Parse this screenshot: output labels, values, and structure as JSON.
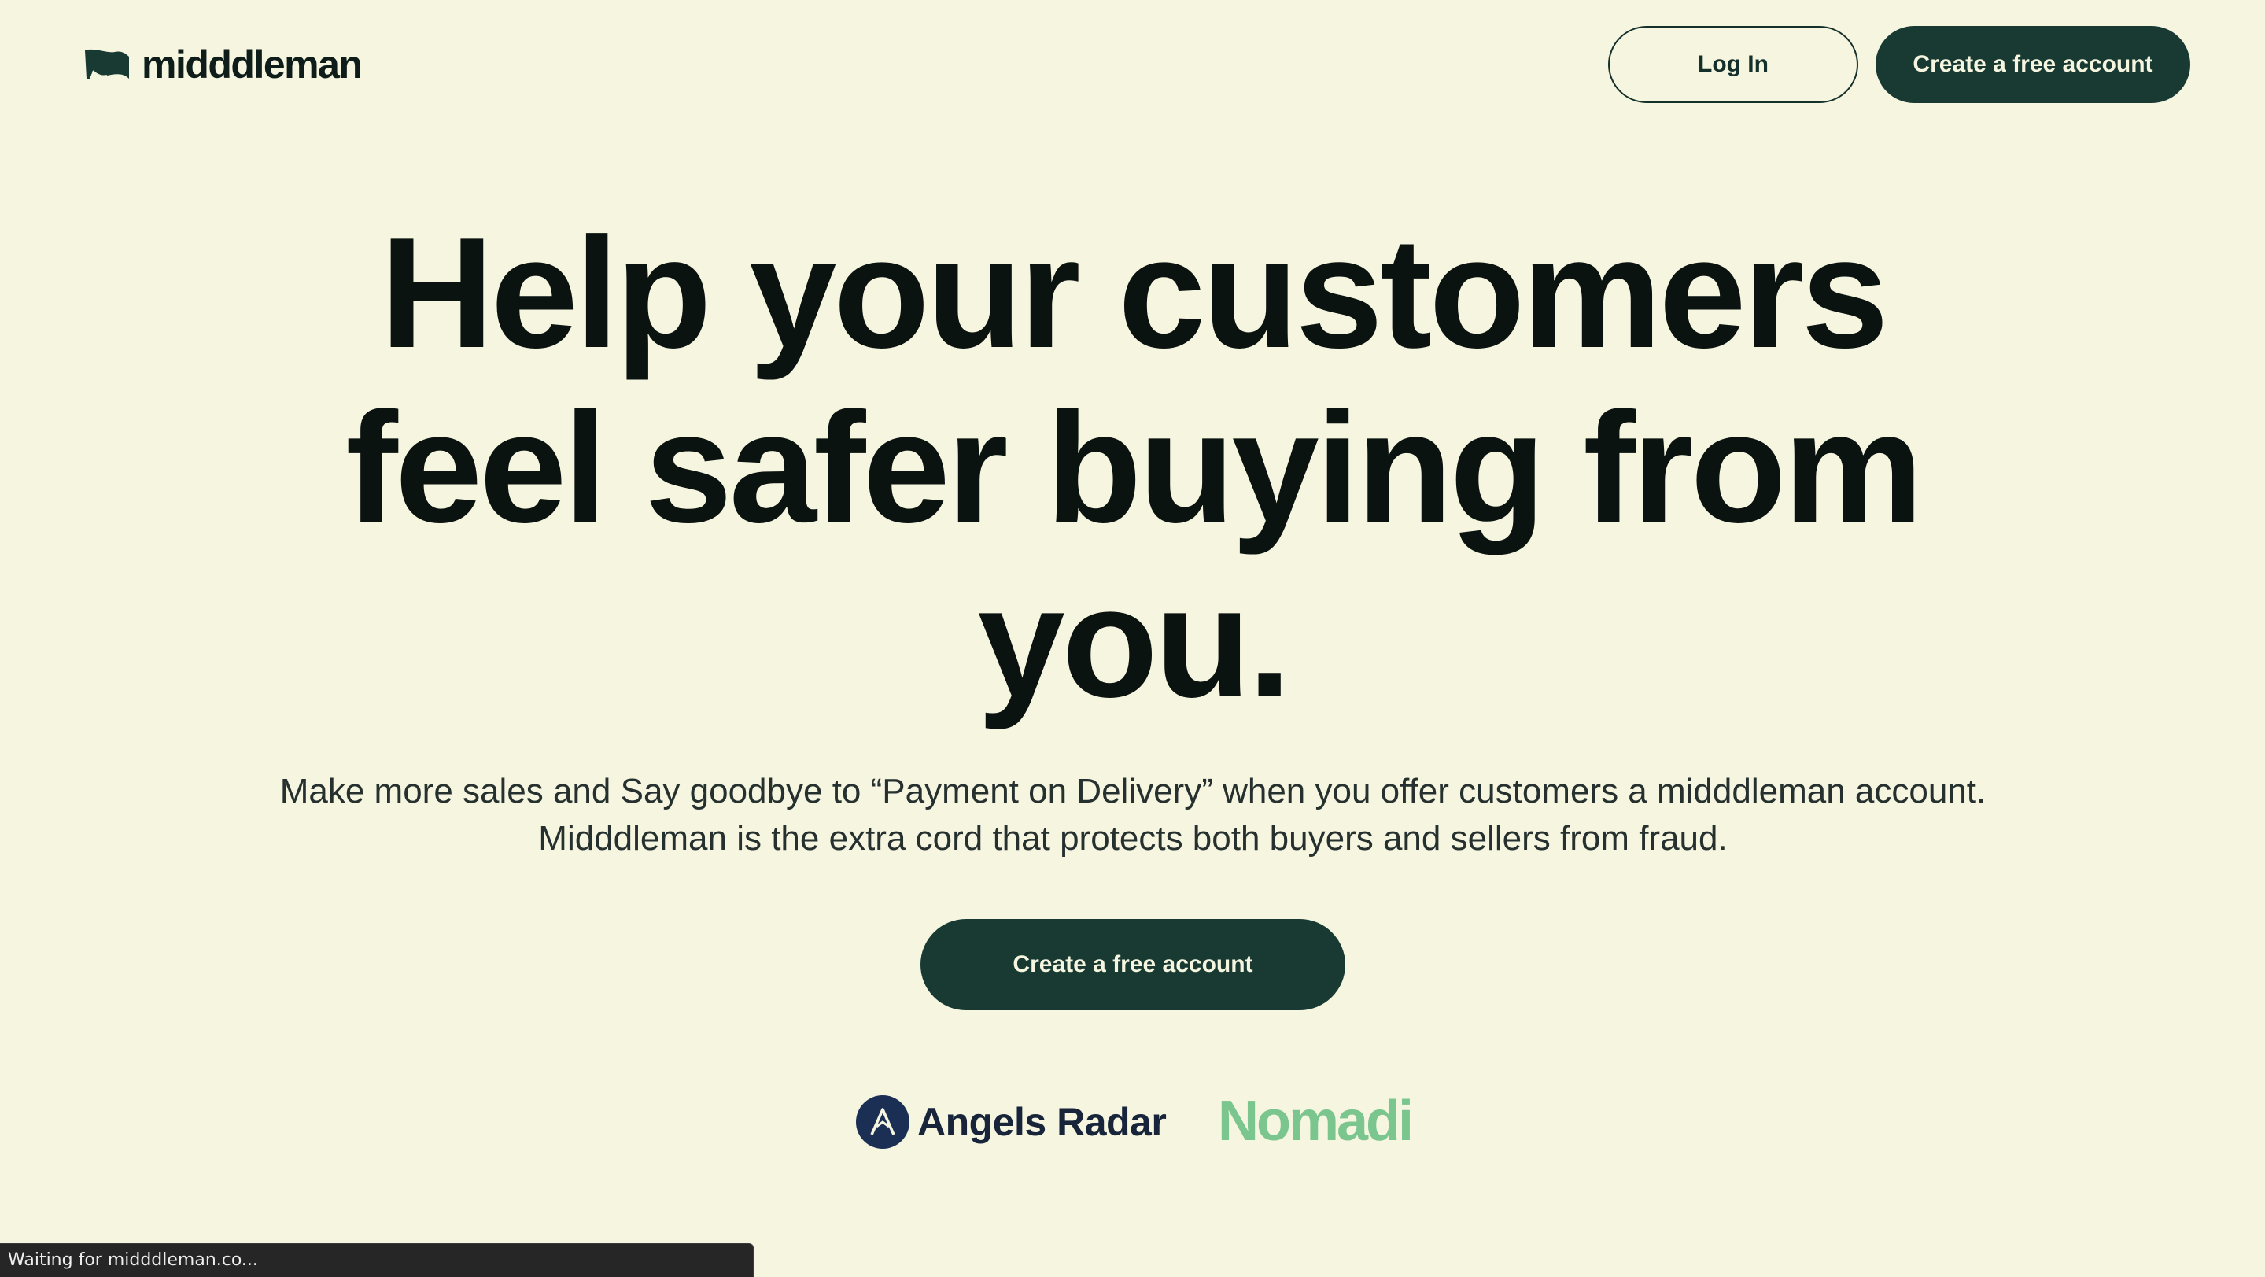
{
  "header": {
    "logo_text": "midddleman",
    "login_label": "Log In",
    "create_account_label": "Create a free account"
  },
  "hero": {
    "title": "Help your customers feel safer buying from you.",
    "subtitle": "Make more sales and Say goodbye to “Payment on Delivery” when you offer customers a midddleman account. Midddleman is the extra cord that protects both buyers and sellers from fraud.",
    "cta_label": "Create a free account"
  },
  "partners": {
    "angels_radar": "Angels Radar",
    "nomadi": "Nomadi"
  },
  "status_bar": {
    "text": "Waiting for midddleman.co..."
  },
  "colors": {
    "background": "#f5f5e0",
    "primary": "#183a33",
    "text": "#0b1311",
    "nomadi_green": "#7bc58e",
    "angels_blue": "#1b2f55"
  },
  "icons": {
    "logo": "flag-logo-icon",
    "angels_radar": "compass-a-logo-icon"
  }
}
